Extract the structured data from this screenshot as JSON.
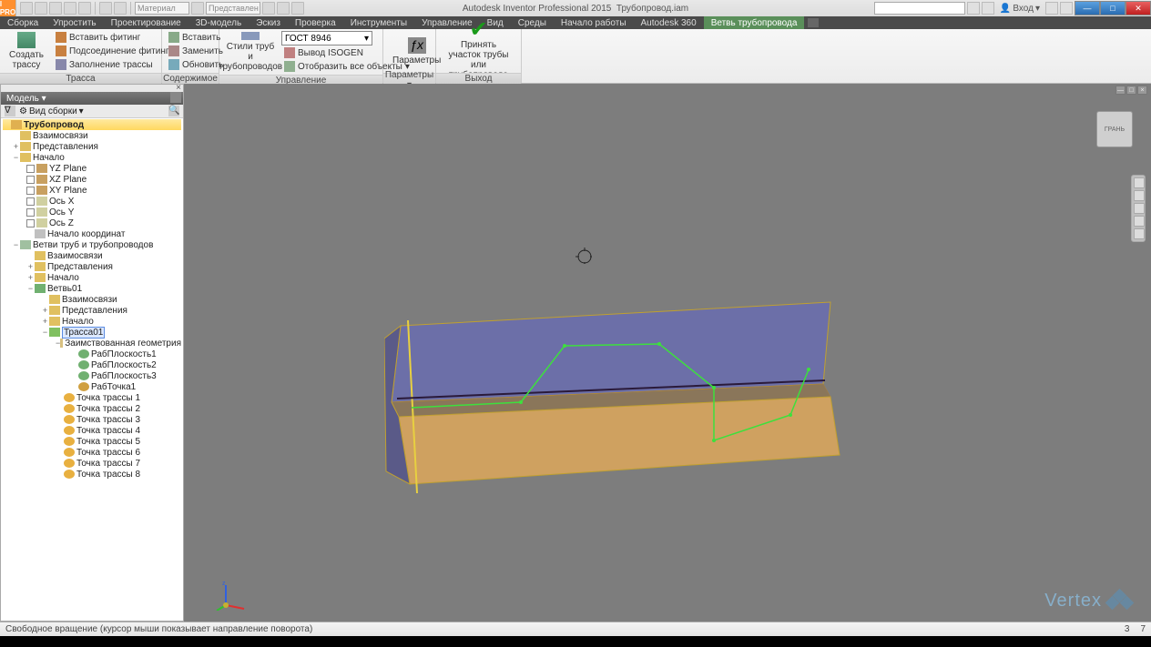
{
  "title": {
    "app": "Autodesk Inventor Professional 2015",
    "doc": "Трубопровод.iam"
  },
  "qat_dropdowns": {
    "material": "Материал",
    "appearance": "Представлен"
  },
  "search": {
    "placeholder": ""
  },
  "login": "Вход",
  "tabs": [
    "Сборка",
    "Упростить",
    "Проектирование",
    "3D-модель",
    "Эскиз",
    "Проверка",
    "Инструменты",
    "Управление",
    "Вид",
    "Среды",
    "Начало работы",
    "Autodesk 360",
    "Ветвь трубопровода"
  ],
  "active_tab": 12,
  "ribbon": {
    "p0": {
      "label": "Трасса",
      "big": "Создать трассу",
      "c0": "Вставить фитинг",
      "c1": "Подсоединение фитингов",
      "c2": "Заполнение трассы"
    },
    "p1": {
      "label": "Содержимое",
      "c0": "Вставить",
      "c1": "Заменить",
      "c2": "Обновить"
    },
    "p2": {
      "label": "Управление",
      "big": "Стили труб\nи трубопроводов",
      "combo": "ГОСТ 8946",
      "c1": "Вывод ISOGEN",
      "c2": "Отобразить все объекты"
    },
    "p3": {
      "label": "Параметры ▾",
      "big": "Параметры"
    },
    "p4": {
      "label": "Выход",
      "big": "Принять участок трубы\nили трубопровода"
    }
  },
  "browser": {
    "title": "Модель ▾",
    "filter": "Вид сборки",
    "root": "Трубопровод",
    "n": {
      "rel": "Взаимосвязи",
      "rep": "Представления",
      "origin": "Начало",
      "yz": "YZ Plane",
      "xz": "XZ Plane",
      "xy": "XY Plane",
      "ax": "Ось X",
      "ay": "Ось Y",
      "az": "Ось Z",
      "ctr": "Начало координат",
      "runs": "Ветви труб и трубопроводов",
      "run1": "Ветвь01",
      "route1": "Трасса01",
      "bgeom": "Заимствованная геометрия",
      "wp1": "РабПлоскость1",
      "wp2": "РабПлоскость2",
      "wp3": "РабПлоскость3",
      "wpt1": "РабТочка1",
      "rp1": "Точка трассы 1",
      "rp2": "Точка трассы 2",
      "rp3": "Точка трассы 3",
      "rp4": "Точка трассы 4",
      "rp5": "Точка трассы 5",
      "rp6": "Точка трассы 6",
      "rp7": "Точка трассы 7",
      "rp8": "Точка трассы 8"
    }
  },
  "viewcube": "ГРАНЬ",
  "status": {
    "msg": "Свободное вращение (курсор мыши показывает направление поворота)",
    "v1": "3",
    "v2": "7"
  },
  "watermark": "Vertex"
}
